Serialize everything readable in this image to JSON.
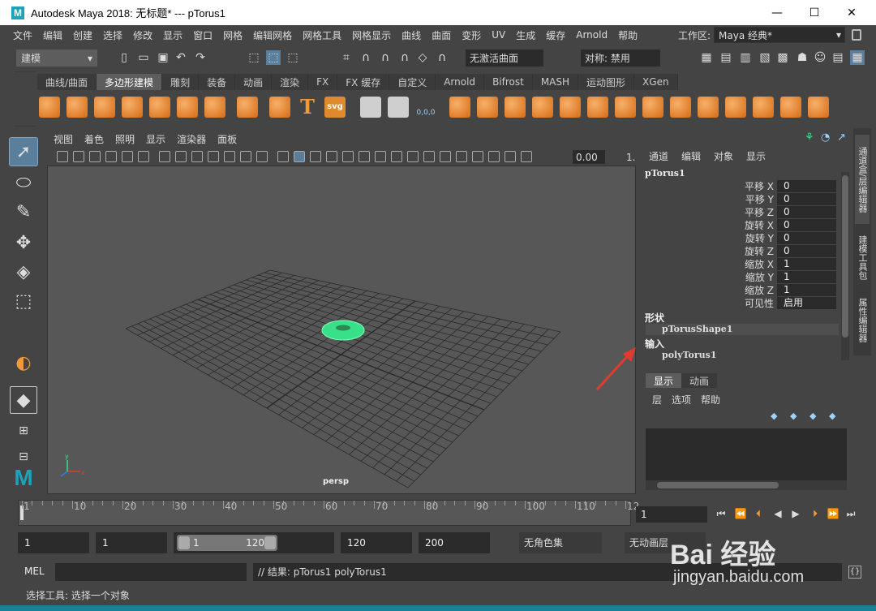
{
  "window": {
    "title": "Autodesk Maya 2018: 无标题*   ---   pTorus1",
    "logo": "M",
    "minimize": "—",
    "maximize": "☐",
    "close": "✕"
  },
  "menubar": {
    "items": [
      "文件",
      "编辑",
      "创建",
      "选择",
      "修改",
      "显示",
      "窗口",
      "网格",
      "编辑网格",
      "网格工具",
      "网格显示",
      "曲线",
      "曲面",
      "变形",
      "UV",
      "生成",
      "缓存",
      "Arnold",
      "帮助"
    ],
    "workspace_label": "工作区:",
    "workspace_value": "Maya 经典*"
  },
  "statusline": {
    "mode": "建模",
    "live_surface": "无激活曲面",
    "symmetry": "对称: 禁用"
  },
  "shelf": {
    "tabs": [
      "曲线/曲面",
      "多边形建模",
      "雕刻",
      "装备",
      "动画",
      "渲染",
      "FX",
      "FX 缓存",
      "自定义",
      "Arnold",
      "Bifrost",
      "MASH",
      "运动图形",
      "XGen"
    ],
    "active_tab": "多边形建模",
    "svg_label": "svg",
    "text_label": "T",
    "counter_label": "0,0,0"
  },
  "viewport": {
    "menu": [
      "视图",
      "着色",
      "照明",
      "显示",
      "渲染器",
      "面板"
    ],
    "value_field": "0.00",
    "value_field2": "1.",
    "camera_label": "persp",
    "axis_x": "x",
    "axis_y": "y",
    "grid_color": "#2a2a2a",
    "torus_color": "#38e08a"
  },
  "channel_box": {
    "menu": [
      "通道",
      "编辑",
      "对象",
      "显示"
    ],
    "object": "pTorus1",
    "attributes": [
      {
        "name": "平移 X",
        "value": "0"
      },
      {
        "name": "平移 Y",
        "value": "0"
      },
      {
        "name": "平移 Z",
        "value": "0"
      },
      {
        "name": "旋转 X",
        "value": "0"
      },
      {
        "name": "旋转 Y",
        "value": "0"
      },
      {
        "name": "旋转 Z",
        "value": "0"
      },
      {
        "name": "缩放 X",
        "value": "1"
      },
      {
        "name": "缩放 Y",
        "value": "1"
      },
      {
        "name": "缩放 Z",
        "value": "1"
      },
      {
        "name": "可见性",
        "value": "启用"
      }
    ],
    "shapes_header": "形状",
    "shape_node": "pTorusShape1",
    "inputs_header": "输入",
    "input_node": "polyTorus1"
  },
  "side_tabs": [
    "通道盒/层编辑器",
    "建模工具包",
    "属性编辑器"
  ],
  "layer_editor": {
    "tabs": [
      "显示",
      "动画"
    ],
    "active_tab": "显示",
    "menu": [
      "层",
      "选项",
      "帮助"
    ]
  },
  "timeline": {
    "ticks": [
      "1",
      "10",
      "20",
      "30",
      "40",
      "50",
      "60",
      "70",
      "80",
      "90",
      "100",
      "110",
      "12"
    ],
    "current_frame": "1"
  },
  "range": {
    "start": "1",
    "playback_start": "1",
    "range_start": "1",
    "range_end": "120",
    "playback_end": "120",
    "end": "200",
    "character_set": "无角色集",
    "anim_layer": "无动画层"
  },
  "command": {
    "language": "MEL",
    "result": "// 结果: pTorus1 polyTorus1",
    "help": "选择工具: 选择一个对象"
  },
  "watermark": {
    "brand": "Bai 经验",
    "url": "jingyan.baidu.com"
  },
  "colors": {
    "accent": "#5a7f9d",
    "panel": "#444444",
    "field": "#2b2b2b",
    "arrow": "#e23b2e"
  }
}
